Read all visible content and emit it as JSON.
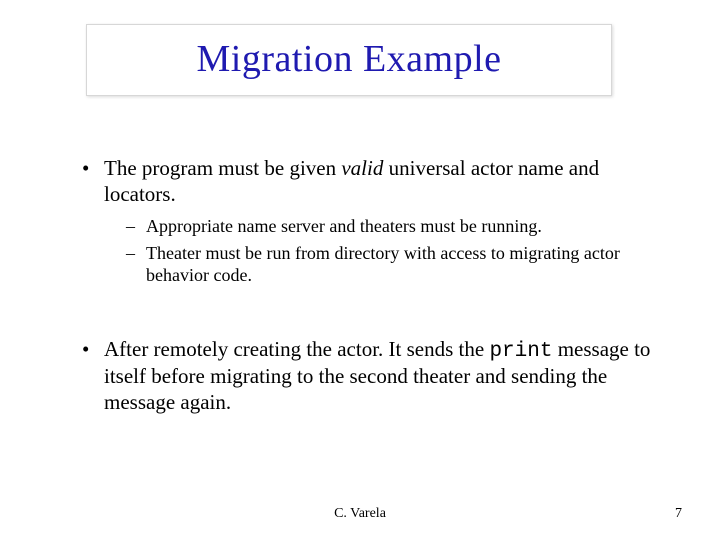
{
  "title": "Migration Example",
  "body": {
    "bullet1": {
      "pre": "The program must be given ",
      "em": "valid",
      "post": " universal actor name and locators.",
      "sub": {
        "a": "Appropriate name server and theaters must be running.",
        "b": "Theater must be run from directory with access to migrating actor behavior code."
      }
    },
    "bullet2": {
      "pre": "After remotely creating the actor. It sends the ",
      "code": "print",
      "post": " message to itself before migrating to the second theater and sending the message again."
    }
  },
  "footer": {
    "author": "C. Varela",
    "page": "7"
  }
}
